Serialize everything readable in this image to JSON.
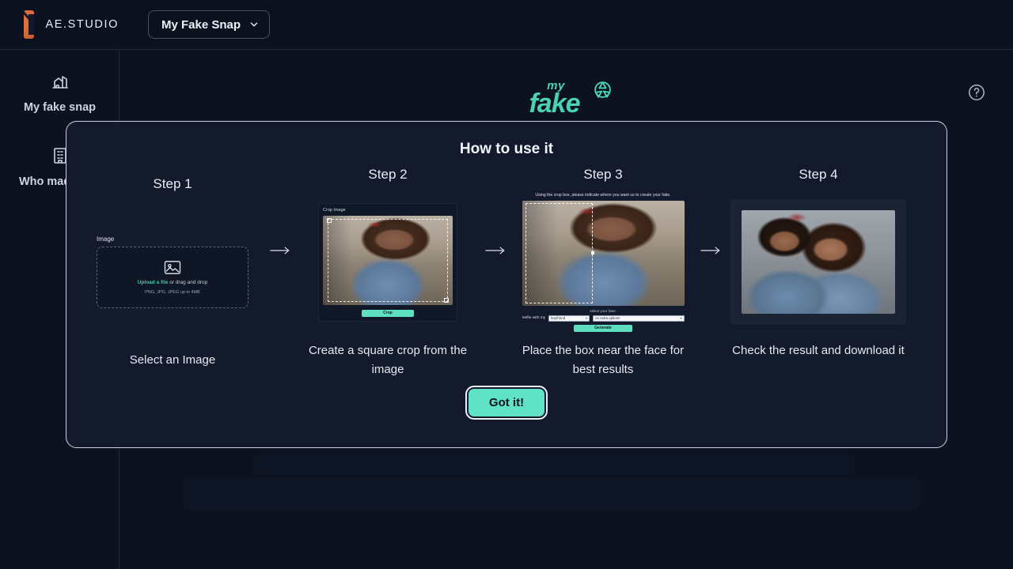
{
  "topbar": {
    "brand_name": "AE.STUDIO",
    "logo_icon": "ae-studio-logo-icon",
    "app_selector": {
      "label": "My Fake Snap",
      "chevron_icon": "chevron-down-icon"
    }
  },
  "sidebar": {
    "items": [
      {
        "label": "My fake snap",
        "icon": "photo-house-icon"
      },
      {
        "label": "Who made this",
        "icon": "building-icon"
      }
    ]
  },
  "page": {
    "logo_top": "my",
    "logo_bottom": "fake",
    "logo_icon": "camera-shutter-icon",
    "help_icon": "question-circle-icon",
    "accent_color": "#49d3b4"
  },
  "modal": {
    "title": "How to use it",
    "confirm_button": "Got it!",
    "arrow_icon": "arrow-right-icon",
    "steps": [
      {
        "title": "Step 1",
        "caption": "Select an Image",
        "upload": {
          "field_label": "Image",
          "icon": "image-placeholder-icon",
          "link_text": "Upload a file",
          "drag_text": " or drag and drop",
          "hint": "PNG, JPG, JPEG up to 4MB"
        }
      },
      {
        "title": "Step 2",
        "caption": "Create a square crop from the image",
        "crop": {
          "header": "Crop Image",
          "button": "Crop"
        }
      },
      {
        "title": "Step 3",
        "caption": "Place the box near the face for best results",
        "place": {
          "header": "Using the crop box, please indicate where you want us to create your fake.",
          "select_label": "select your fake:",
          "form_label": "Selfie with my",
          "select_1": "boyfriend",
          "select_2": "no extra options",
          "chevron_icon": "chevron-down-icon",
          "button": "Generate"
        }
      },
      {
        "title": "Step 4",
        "caption": "Check the result and download it"
      }
    ]
  }
}
